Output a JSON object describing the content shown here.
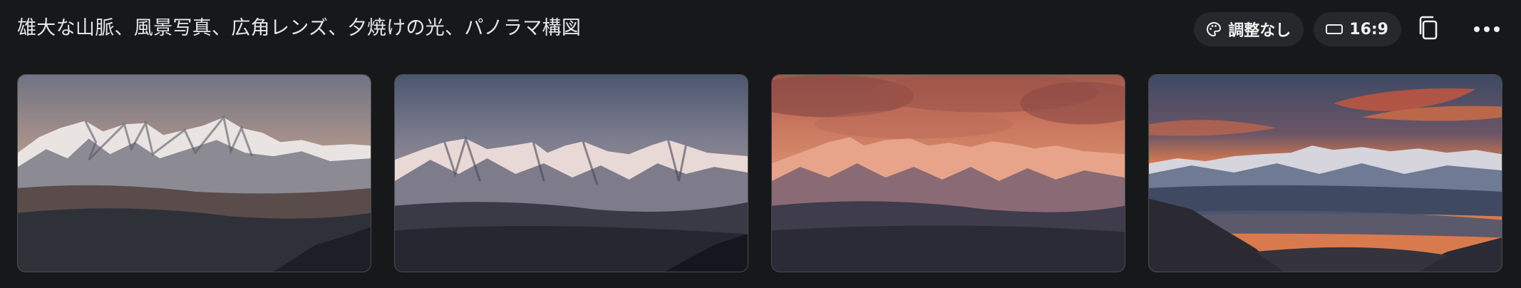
{
  "prompt": {
    "text": "雄大な山脈、風景写真、広角レンズ、夕焼けの光、パノラマ構図"
  },
  "controls": {
    "style_label": "調整なし",
    "style_icon": "palette-icon",
    "ratio_label": "16:9",
    "ratio_icon": "aspect-ratio-icon",
    "copy_icon": "copy-icon",
    "more_icon": "more-horizontal-icon"
  },
  "images": [
    {
      "subject": "snowy mountain range at dusk, soft peach sky"
    },
    {
      "subject": "snowy peaks lit pink under pale blue sky"
    },
    {
      "subject": "peaks under fiery orange clouds"
    },
    {
      "subject": "dramatic red sunset over mountain range and valley"
    }
  ],
  "colors": {
    "background": "#17181a",
    "pill_background": "#26282b",
    "text": "#e6e6e6"
  }
}
